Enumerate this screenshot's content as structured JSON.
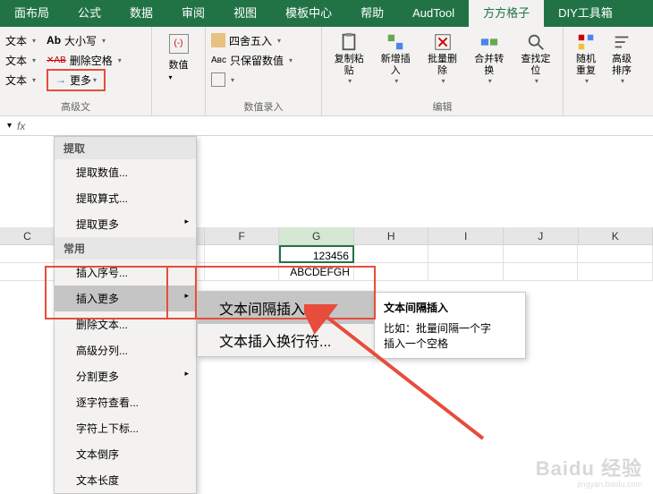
{
  "tabs": [
    "面布局",
    "公式",
    "数据",
    "审阅",
    "视图",
    "模板中心",
    "帮助",
    "AudTool",
    "方方格子",
    "DIY工具箱"
  ],
  "active_tab_index": 8,
  "ribbon": {
    "text_group": {
      "row1_label": "文本",
      "row1_btn": "大小写",
      "row2_label": "文本",
      "row2_btn": "删除空格",
      "row3_label": "文本",
      "more_btn": "更多",
      "group_label": "高级文"
    },
    "value_group": {
      "big_label": "数值",
      "opt1": "四舍五入",
      "opt2": "只保留数值",
      "group_label": "数值录入"
    },
    "edit_group": {
      "b1": "复制粘贴",
      "b2": "新增插入",
      "b3": "批量删除",
      "b4": "合并转换",
      "b5": "查找定位",
      "group_label": "编辑"
    },
    "other_group": {
      "b1": "随机重复",
      "b2": "高级排序"
    }
  },
  "menu": {
    "section1": "提取",
    "items1": [
      "提取数值...",
      "提取算式...",
      "提取更多"
    ],
    "section2": "常用",
    "items2": [
      "插入序号...",
      "插入更多",
      "删除文本...",
      "高级分列...",
      "分割更多",
      "逐字符查看...",
      "字符上下标...",
      "文本倒序",
      "文本长度"
    ]
  },
  "submenu": {
    "i1": "文本间隔插入...",
    "i2": "文本插入换行符..."
  },
  "tooltip": {
    "title": "文本间隔插入",
    "body1": "比如：批量间隔一个字",
    "body2": "插入一个空格"
  },
  "formula_bar": {
    "fx": "fx"
  },
  "columns": [
    "C",
    "F",
    "G",
    "H",
    "I",
    "J",
    "K"
  ],
  "cells": {
    "G1": "123456",
    "G2": "ABCDEFGH"
  },
  "watermark": "Baidu 经验",
  "watermark_sub": "jingyan.baidu.com"
}
